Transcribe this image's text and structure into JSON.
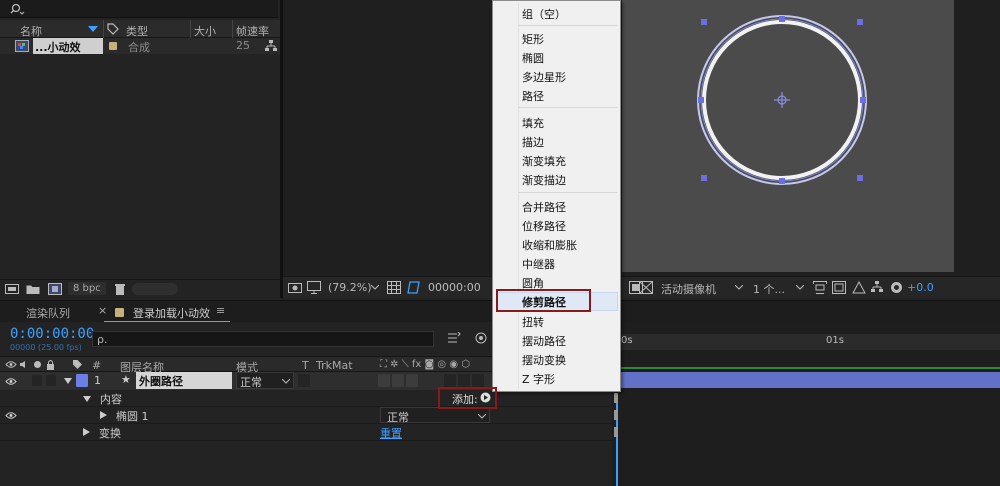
{
  "project": {
    "search_icon": "search-icon",
    "columns": {
      "name": "名称",
      "type": "类型",
      "size": "大小",
      "fps": "帧速率"
    },
    "item": {
      "name": "...小动效",
      "type": "合成",
      "fps": "25"
    },
    "bpc": "8 bpc"
  },
  "viewer": {
    "zoom": "(79.2%)",
    "timecode": "00000:00",
    "camera": "活动摄像机",
    "views": "1 个...",
    "exposure": "+0.0"
  },
  "timeline": {
    "tab_render": "渲染队列",
    "tab_comp": "登录加载小动效",
    "timecode": "0:00:00:00",
    "fps": "00000 (25.00 fps)",
    "search_placeholder": "ρ.",
    "headers": {
      "num": "#",
      "name": "图层名称",
      "mode": "模式",
      "t": "T",
      "trkmat": "TrkMat"
    },
    "layer": {
      "num": "1",
      "name": "外圈路径",
      "mode": "正常"
    },
    "contents": "内容",
    "add_label": "添加:",
    "ellipse": "椭圆 1",
    "ellipse_mode": "正常",
    "transform": "变换",
    "reset": "重置",
    "ruler_0": "0s",
    "ruler_1": "01s"
  },
  "menu": {
    "items": [
      "组（空）",
      "矩形",
      "椭圆",
      "多边星形",
      "路径",
      "填充",
      "描边",
      "渐变填充",
      "渐变描边",
      "合并路径",
      "位移路径",
      "收缩和膨胀",
      "中继器",
      "圆角",
      "修剪路径",
      "扭转",
      "摆动路径",
      "摆动变换",
      "Z 字形"
    ],
    "highlighted": "修剪路径"
  },
  "colors": {
    "accent": "#3da0ff",
    "highlight_box": "#8a1a1a",
    "layer_label": "#6b7fe6",
    "track_bar": "#6270c8",
    "project_label": "#c8b07a"
  }
}
